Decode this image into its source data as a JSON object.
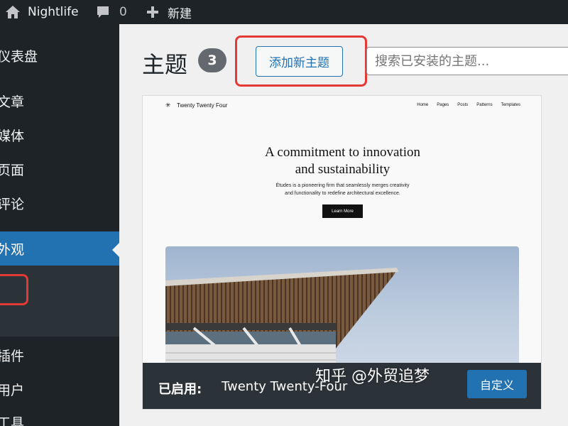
{
  "adminbar": {
    "site_name": "Nightlife",
    "comment_count": "0",
    "new_label": "新建"
  },
  "sidebar": {
    "items": [
      {
        "label": "仪表盘"
      },
      {
        "label": "文章"
      },
      {
        "label": "媒体"
      },
      {
        "label": "页面"
      },
      {
        "label": "评论"
      },
      {
        "label": "外观"
      },
      {
        "label": "插件"
      },
      {
        "label": "用户"
      },
      {
        "label": "工具"
      }
    ]
  },
  "main": {
    "title": "主题",
    "theme_count": "3",
    "add_button": "添加新主题",
    "search_placeholder": "搜索已安装的主题..."
  },
  "theme_card": {
    "preview": {
      "site_title": "Twenty Twenty Four",
      "nav": [
        "Home",
        "Pages",
        "Posts",
        "Patterns",
        "Templates"
      ],
      "headline_line1": "A commitment to innovation",
      "headline_line2": "and sustainability",
      "subtext_line1": "Études is a pioneering firm that seamlessly merges creativity",
      "subtext_line2": "and functionality to redefine architectural excellence.",
      "cta": "Learn More"
    },
    "active_label": "已启用:",
    "active_theme": "Twenty Twenty-Four",
    "customize_button": "自定义"
  },
  "watermark": "知乎 @外贸追梦",
  "colors": {
    "admin_dark": "#1d2327",
    "accent_blue": "#2271b1",
    "highlight_red": "#e53935",
    "submenu_bg": "#2c3338"
  }
}
